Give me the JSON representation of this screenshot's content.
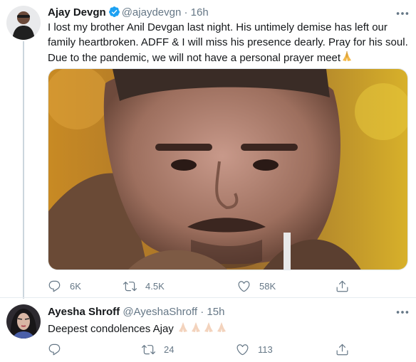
{
  "tweet1": {
    "name": "Ajay Devgn",
    "handle": "@ajaydevgn",
    "dot": "·",
    "time": "16h",
    "text": "I lost my brother Anil Devgan last night. His untimely demise has left our family heartbroken. ADFF & I will miss his presence dearly. Pray for his soul. Due to the pandemic, we will not have a personal prayer meet",
    "actions": {
      "reply_count": "6K",
      "retweet_count": "4.5K",
      "like_count": "58K"
    },
    "verified": true
  },
  "tweet2": {
    "name": "Ayesha Shroff",
    "handle": "@AyeshaShroff",
    "dot": "·",
    "time": "15h",
    "text": "Deepest condolences Ajay",
    "actions": {
      "reply_count": "",
      "retweet_count": "24",
      "like_count": "113"
    }
  },
  "colors": {
    "accent": "#1da1f2",
    "secondary_text": "#657786",
    "divider": "#e6ecf0"
  },
  "icons": [
    "reply-icon",
    "retweet-icon",
    "like-icon",
    "share-icon",
    "more-icon",
    "verified-icon",
    "folded-hands-emoji"
  ]
}
